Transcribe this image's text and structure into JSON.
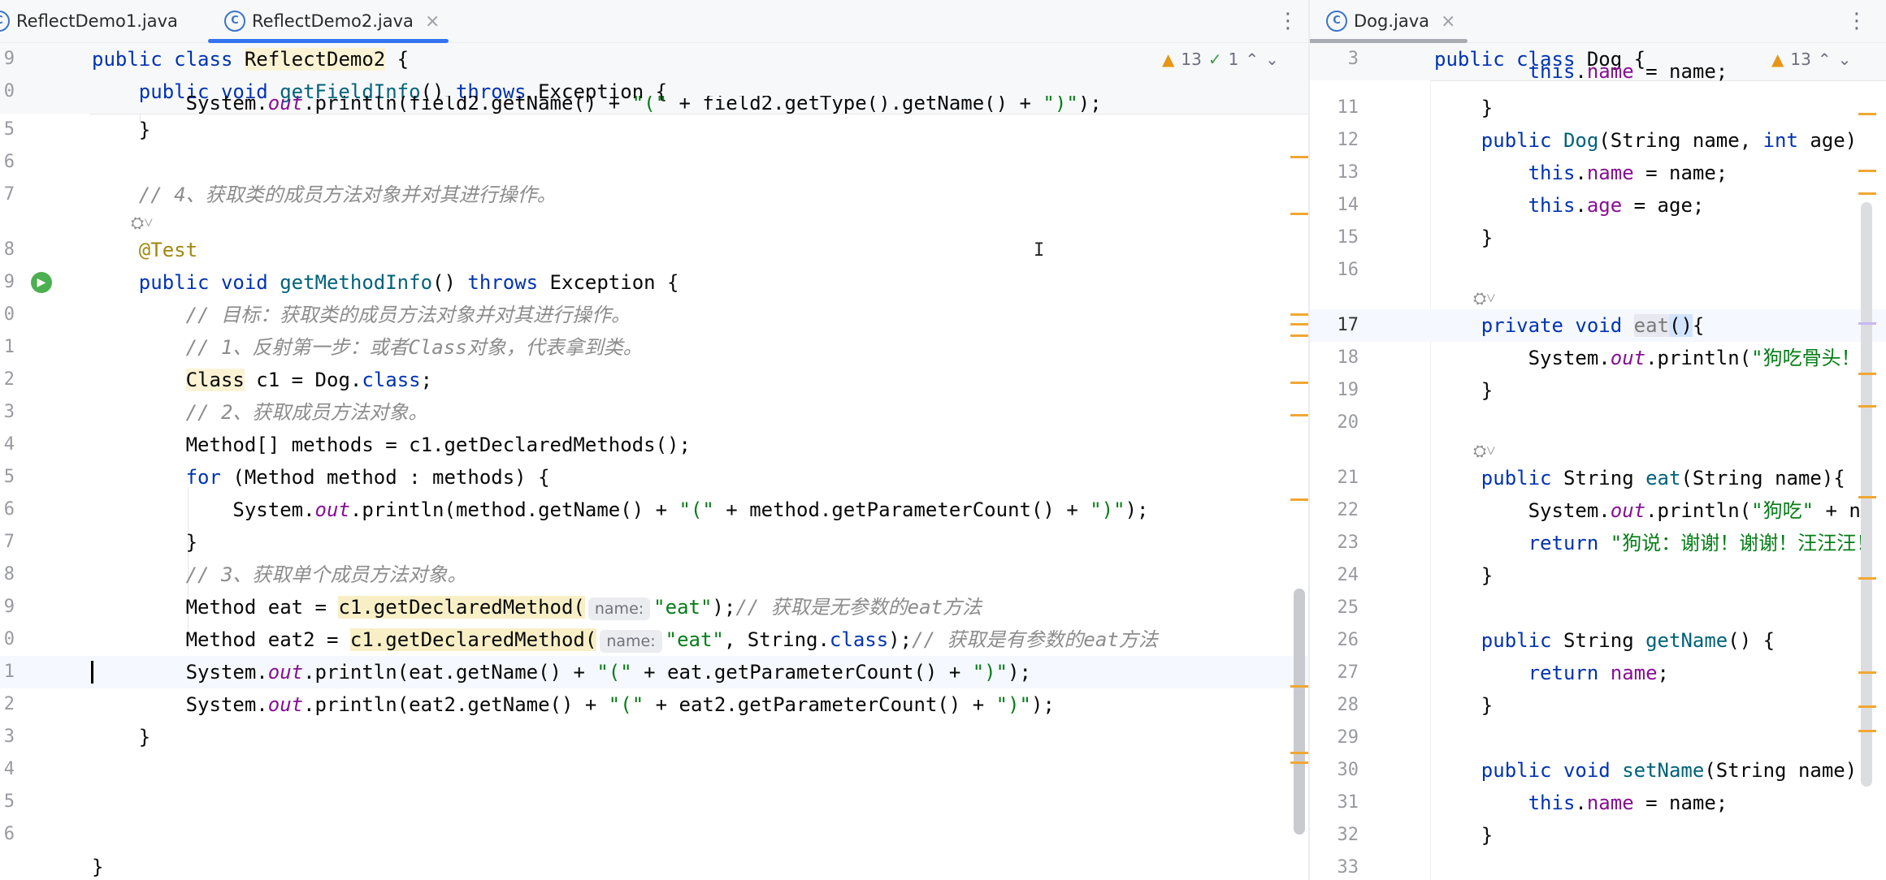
{
  "left_editor": {
    "tabs": [
      {
        "label": "ReflectDemo1.java",
        "active": false
      },
      {
        "label": "ReflectDemo2.java",
        "active": true
      }
    ],
    "tab_icon_glyph": "C",
    "close_glyph": "×",
    "menu_glyph": "⋮",
    "inspection": {
      "warnings": "13",
      "checks": "1",
      "warn_glyph": "▲",
      "check_glyph": "✓",
      "up": "⌃",
      "down": "⌄"
    },
    "sticky_lines": [
      {
        "num": "9",
        "code": "public class ReflectDemo2 {"
      },
      {
        "num": "0",
        "code": "    public void getFieldInfo() throws Exception {"
      }
    ],
    "partial_line": "        System.out.println(field2.getName() + \"(\" + field2.getType().getName() + \")\");",
    "lines": [
      {
        "num": "5",
        "code": "    }"
      },
      {
        "num": "6",
        "code": ""
      },
      {
        "num": "7",
        "code": "    // 4、获取类的成员方法对象并对其进行操作。"
      },
      {
        "num": "",
        "code": "    ⛭˅"
      },
      {
        "num": "8",
        "code": "    @Test"
      },
      {
        "num": "9",
        "code": "    public void getMethodInfo() throws Exception {"
      },
      {
        "num": "0",
        "code": "        // 目标：获取类的成员方法对象并对其进行操作。"
      },
      {
        "num": "1",
        "code": "        // 1、反射第一步：或者Class对象，代表拿到类。"
      },
      {
        "num": "2",
        "code": "        Class c1 = Dog.class;"
      },
      {
        "num": "3",
        "code": "        // 2、获取成员方法对象。"
      },
      {
        "num": "4",
        "code": "        Method[] methods = c1.getDeclaredMethods();"
      },
      {
        "num": "5",
        "code": "        for (Method method : methods) {"
      },
      {
        "num": "6",
        "code": "            System.out.println(method.getName() + \"(\" + method.getParameterCount() + \")\");"
      },
      {
        "num": "7",
        "code": "        }"
      },
      {
        "num": "8",
        "code": "        // 3、获取单个成员方法对象。"
      },
      {
        "num": "9",
        "code": "        Method eat = c1.getDeclaredMethod(name: \"eat\");// 获取是无参数的eat方法"
      },
      {
        "num": "0",
        "code": "        Method eat2 = c1.getDeclaredMethod(name: \"eat\", String.class);// 获取是有参数的eat方法"
      },
      {
        "num": "1",
        "code": "        System.out.println(eat.getName() + \"(\" + eat.getParameterCount() + \")\");"
      },
      {
        "num": "2",
        "code": "        System.out.println(eat2.getName() + \"(\" + eat2.getParameterCount() + \")\");"
      },
      {
        "num": "3",
        "code": "    }"
      },
      {
        "num": "4",
        "code": ""
      },
      {
        "num": "5",
        "code": ""
      },
      {
        "num": "6",
        "code": ""
      },
      {
        "num": "",
        "code": "}"
      }
    ],
    "hint_label": "name:",
    "run_icon_glyph": "▶"
  },
  "right_editor": {
    "tab": {
      "label": "Dog.java",
      "active": true
    },
    "inspection": {
      "warnings": "13"
    },
    "sticky_lines": [
      {
        "num": "3",
        "code": "public class Dog {"
      }
    ],
    "partial_line": "        this.name = name;",
    "lines": [
      {
        "num": "11",
        "code": "    }"
      },
      {
        "num": "12",
        "code": "    public Dog(String name, int age)"
      },
      {
        "num": "13",
        "code": "        this.name = name;"
      },
      {
        "num": "14",
        "code": "        this.age = age;"
      },
      {
        "num": "15",
        "code": "    }"
      },
      {
        "num": "16",
        "code": ""
      },
      {
        "num": "",
        "code": "    ⛭˅"
      },
      {
        "num": "17",
        "code": "    private void eat(){"
      },
      {
        "num": "18",
        "code": "        System.out.println(\"狗吃骨头！\""
      },
      {
        "num": "19",
        "code": "    }"
      },
      {
        "num": "20",
        "code": ""
      },
      {
        "num": "",
        "code": "    ⛭˅"
      },
      {
        "num": "21",
        "code": "    public String eat(String name){"
      },
      {
        "num": "22",
        "code": "        System.out.println(\"狗吃\" + na"
      },
      {
        "num": "23",
        "code": "        return \"狗说：谢谢！谢谢！汪汪汪！"
      },
      {
        "num": "24",
        "code": "    }"
      },
      {
        "num": "25",
        "code": ""
      },
      {
        "num": "26",
        "code": "    public String getName() {"
      },
      {
        "num": "27",
        "code": "        return name;"
      },
      {
        "num": "28",
        "code": "    }"
      },
      {
        "num": "29",
        "code": ""
      },
      {
        "num": "30",
        "code": "    public void setName(String name)"
      },
      {
        "num": "31",
        "code": "        this.name = name;"
      },
      {
        "num": "32",
        "code": "    }"
      },
      {
        "num": "33",
        "code": ""
      }
    ]
  },
  "colors": {
    "keyword": "#0033b3",
    "method": "#00627a",
    "string": "#067d17",
    "comment": "#8c8c8c",
    "field": "#871094",
    "annotation": "#9e880d",
    "tab_underline": "#3574f0",
    "warning": "#e69516"
  }
}
